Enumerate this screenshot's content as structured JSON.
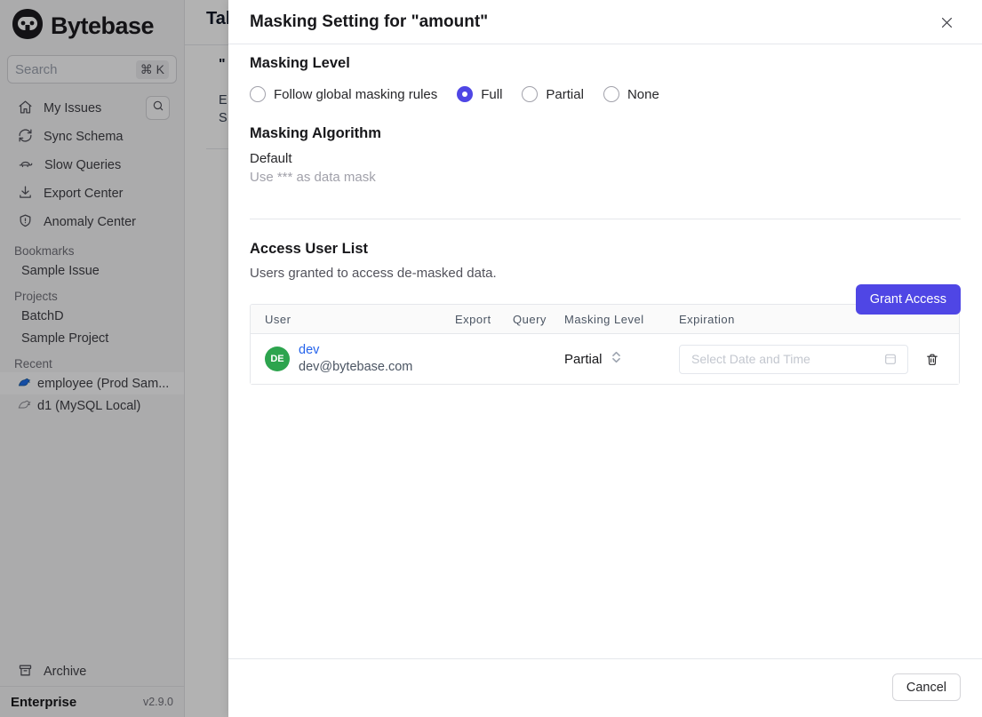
{
  "colors": {
    "accent": "#4f46e5",
    "avatar_green": "#2da44e",
    "link_blue": "#2563eb"
  },
  "sidebar": {
    "logo_text": "Bytebase",
    "search": {
      "placeholder": "Search",
      "shortcut": "⌘ K"
    },
    "nav": [
      {
        "icon": "home-icon",
        "label": "My Issues"
      },
      {
        "icon": "sync-icon",
        "label": "Sync Schema"
      },
      {
        "icon": "turtle-icon",
        "label": "Slow Queries"
      },
      {
        "icon": "download-icon",
        "label": "Export Center"
      },
      {
        "icon": "shield-icon",
        "label": "Anomaly Center"
      }
    ],
    "sections": [
      {
        "label": "Bookmarks",
        "items": [
          {
            "label": "Sample Issue"
          }
        ]
      },
      {
        "label": "Projects",
        "items": [
          {
            "label": "BatchD"
          },
          {
            "label": "Sample Project"
          }
        ]
      },
      {
        "label": "Recent",
        "items": [
          {
            "label": "employee (Prod Sam...",
            "icon": "mysql-icon",
            "selected": true
          },
          {
            "label": "d1 (MySQL Local)",
            "icon": "mysql-outline-icon",
            "selected": false
          }
        ]
      }
    ],
    "archive_label": "Archive",
    "footer": {
      "plan": "Enterprise",
      "version": "v2.9.0"
    }
  },
  "background_page": {
    "heading_clipped": "Tab",
    "fragment_quote": "\"",
    "fragment_e": "E",
    "fragment_s": "S"
  },
  "modal": {
    "title": "Masking Setting for \"amount\"",
    "masking_level": {
      "heading": "Masking Level",
      "options": [
        {
          "label": "Follow global masking rules",
          "selected": false
        },
        {
          "label": "Full",
          "selected": true
        },
        {
          "label": "Partial",
          "selected": false
        },
        {
          "label": "None",
          "selected": false
        }
      ]
    },
    "masking_algorithm": {
      "heading": "Masking Algorithm",
      "value": "Default",
      "description": "Use *** as data mask"
    },
    "access_user_list": {
      "heading": "Access User List",
      "subtitle": "Users granted to access de-masked data.",
      "grant_button": "Grant Access",
      "table": {
        "columns": [
          "User",
          "Export",
          "Query",
          "Masking Level",
          "Expiration"
        ],
        "rows": [
          {
            "avatar": "DE",
            "name": "dev",
            "email": "dev@bytebase.com",
            "export_checked": true,
            "query_checked": true,
            "masking_level": "Partial",
            "expiration_placeholder": "Select Date and Time"
          }
        ]
      }
    },
    "footer": {
      "cancel_label": "Cancel"
    }
  }
}
